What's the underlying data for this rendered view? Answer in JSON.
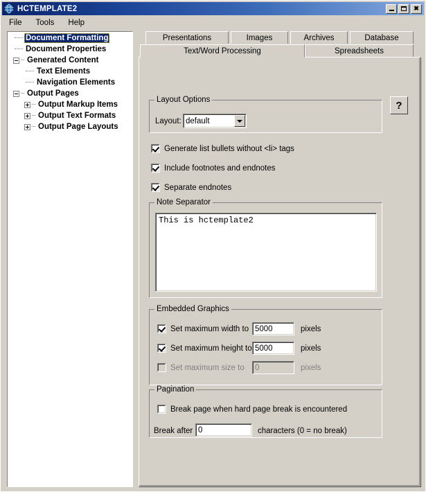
{
  "window": {
    "title": "HCTEMPLATE2",
    "icon": "globe-icon",
    "minimize_label": "_",
    "maximize_label": "□",
    "close_label": "✕"
  },
  "menubar": {
    "items": [
      {
        "label": "File"
      },
      {
        "label": "Tools"
      },
      {
        "label": "Help"
      }
    ]
  },
  "tree": {
    "nodes": [
      {
        "label": "Document Formatting",
        "depth": 1,
        "toggle": "none",
        "selected": true
      },
      {
        "label": "Document Properties",
        "depth": 1,
        "toggle": "none",
        "selected": false
      },
      {
        "label": "Generated Content",
        "depth": 0,
        "toggle": "minus",
        "selected": false
      },
      {
        "label": "Text Elements",
        "depth": 2,
        "toggle": "none",
        "selected": false
      },
      {
        "label": "Navigation Elements",
        "depth": 2,
        "toggle": "none",
        "selected": false
      },
      {
        "label": "Output Pages",
        "depth": 0,
        "toggle": "minus",
        "selected": false
      },
      {
        "label": "Output Markup Items",
        "depth": 1,
        "toggle": "plus",
        "selected": false
      },
      {
        "label": "Output Text Formats",
        "depth": 1,
        "toggle": "plus",
        "selected": false
      },
      {
        "label": "Output Page Layouts",
        "depth": 1,
        "toggle": "plus",
        "selected": false
      }
    ]
  },
  "tabs": {
    "row1": [
      {
        "label": "Presentations",
        "active": false
      },
      {
        "label": "Images",
        "active": false
      },
      {
        "label": "Archives",
        "active": false
      },
      {
        "label": "Database",
        "active": false
      }
    ],
    "row2": [
      {
        "label": "Text/Word Processing",
        "active": true
      },
      {
        "label": "Spreadsheets",
        "active": false
      }
    ]
  },
  "help_button": {
    "label": "?"
  },
  "layout_options": {
    "title": "Layout Options",
    "layout_label": "Layout:",
    "layout_value": "default",
    "layout_options": [
      "default"
    ]
  },
  "options": [
    {
      "label": "Generate list bullets without <li> tags",
      "checked": true
    },
    {
      "label": "Include footnotes and endnotes",
      "checked": true
    },
    {
      "label": "Separate endnotes",
      "checked": true
    }
  ],
  "note_separator": {
    "title": "Note Separator",
    "value": "This is hctemplate2"
  },
  "embedded_graphics": {
    "title": "Embedded Graphics",
    "rows": [
      {
        "label": "Set maximum width to",
        "checked": true,
        "value": "5000",
        "unit": "pixels",
        "disabled": false
      },
      {
        "label": "Set maximum height to",
        "checked": true,
        "value": "5000",
        "unit": "pixels",
        "disabled": false
      },
      {
        "label": "Set maximum size to",
        "checked": false,
        "value": "0",
        "unit": "pixels",
        "disabled": true
      }
    ]
  },
  "pagination": {
    "title": "Pagination",
    "hard_break_label": "Break page when hard page break is encountered",
    "hard_break_checked": false,
    "break_after_label": "Break after",
    "break_after_value": "0",
    "break_after_suffix": "characters (0 = no break)"
  },
  "colors": {
    "face": "#d4d0c8",
    "title_start": "#0a246a",
    "title_end": "#86aadf",
    "selection": "#0a246a",
    "disabled_text": "#808080"
  }
}
